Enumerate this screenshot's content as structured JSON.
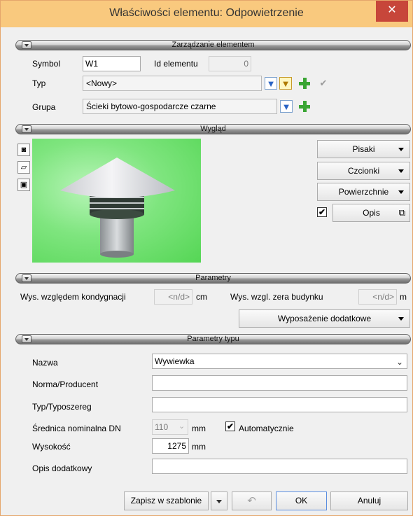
{
  "window": {
    "title": "Właściwości elementu: Odpowietrzenie",
    "close_glyph": "✕"
  },
  "sections": {
    "zarzadzanie": "Zarządzanie elementem",
    "wyglad": "Wygląd",
    "parametry": "Parametry",
    "parametry_typu": "Parametry typu"
  },
  "element": {
    "symbol_label": "Symbol",
    "symbol_value": "W1",
    "id_label": "Id elementu",
    "id_value": "0",
    "typ_label": "Typ",
    "typ_value": "<Nowy>",
    "grupa_label": "Grupa",
    "grupa_value": "Ścieki bytowo-gospodarcze czarne"
  },
  "wyglad": {
    "pisaki": "Pisaki",
    "czcionki": "Czcionki",
    "powierzchnie": "Powierzchnie",
    "opis": "Opis",
    "opis_checked": "✔"
  },
  "parametry": {
    "wys_kondygnacji_label": "Wys. względem kondygnacji",
    "wys_kondygnacji_value": "<n/d>",
    "wys_kondygnacji_unit": "cm",
    "wys_zera_label": "Wys. wzgl. zera budynku",
    "wys_zera_value": "<n/d>",
    "wys_zera_unit": "m",
    "wyposazenie": "Wyposażenie dodatkowe"
  },
  "parametry_typu": {
    "nazwa_label": "Nazwa",
    "nazwa_value": "Wywiewka",
    "norma_label": "Norma/Producent",
    "norma_value": "",
    "typ_label": "Typ/Typoszereg",
    "typ_value": "",
    "srednica_label": "Średnica nominalna DN",
    "srednica_value": "110",
    "srednica_unit": "mm",
    "automatycznie_label": "Automatycznie",
    "automatycznie_checked": "✔",
    "wysokosc_label": "Wysokość",
    "wysokosc_value": "1275",
    "wysokosc_unit": "mm",
    "opis_label": "Opis dodatkowy",
    "opis_value": ""
  },
  "footer": {
    "zapisz": "Zapisz w szablonie",
    "ok": "OK",
    "anuluj": "Anuluj"
  },
  "colors": {
    "titlebar": "#f9c97e",
    "close": "#c7463a",
    "preview_bg": "#7fe57f"
  }
}
